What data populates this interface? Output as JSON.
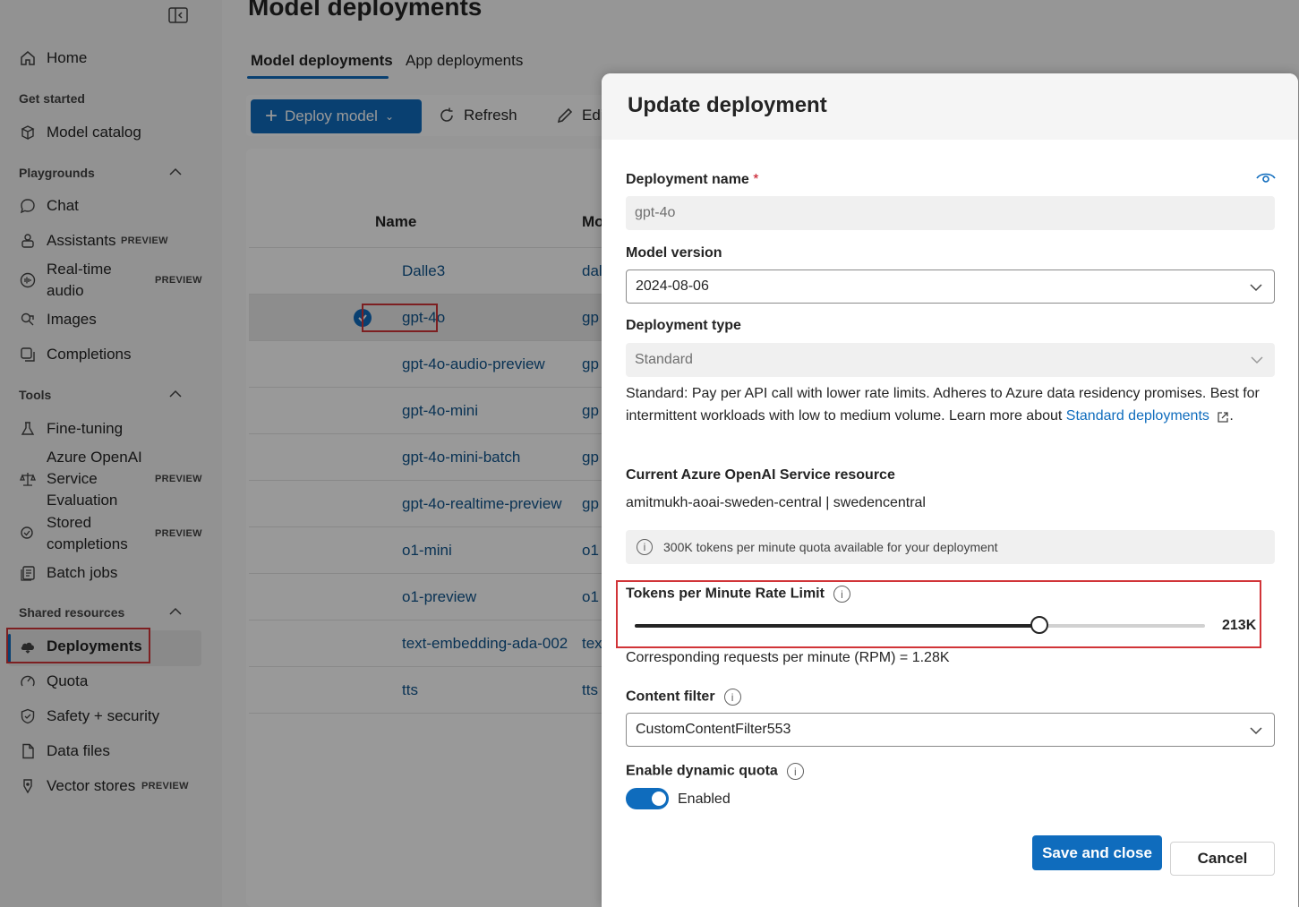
{
  "sidebar": {
    "home": "Home",
    "get_started": "Get started",
    "model_catalog": "Model catalog",
    "playgrounds": "Playgrounds",
    "chat": "Chat",
    "assistants": "Assistants",
    "realtime_audio_1": "Real-time",
    "realtime_audio_2": "audio",
    "images": "Images",
    "completions": "Completions",
    "tools": "Tools",
    "fine_tuning": "Fine-tuning",
    "aoai_eval_1": "Azure OpenAI",
    "aoai_eval_2": "Service",
    "aoai_eval_3": "Evaluation",
    "stored_1": "Stored",
    "stored_2": "completions",
    "batch_jobs": "Batch jobs",
    "shared_resources": "Shared resources",
    "deployments": "Deployments",
    "quota": "Quota",
    "safety": "Safety + security",
    "data_files": "Data files",
    "vector_stores": "Vector stores",
    "preview_badge": "PREVIEW"
  },
  "main": {
    "title": "Model deployments",
    "tab_model": "Model deployments",
    "tab_app": "App deployments",
    "deploy_model": "Deploy model",
    "refresh": "Refresh",
    "edit": "Edi",
    "col_name": "Name",
    "col_model": "Mo",
    "rows": [
      {
        "name": "Dalle3",
        "model": "dal"
      },
      {
        "name": "gpt-4o",
        "model": "gp"
      },
      {
        "name": "gpt-4o-audio-preview",
        "model": "gp"
      },
      {
        "name": "gpt-4o-mini",
        "model": "gp"
      },
      {
        "name": "gpt-4o-mini-batch",
        "model": "gp"
      },
      {
        "name": "gpt-4o-realtime-preview",
        "model": "gp"
      },
      {
        "name": "o1-mini",
        "model": "o1"
      },
      {
        "name": "o1-preview",
        "model": "o1"
      },
      {
        "name": "text-embedding-ada-002",
        "model": "tex"
      },
      {
        "name": "tts",
        "model": "tts"
      }
    ]
  },
  "panel": {
    "title": "Update deployment",
    "deployment_name_label": "Deployment name",
    "required_mark": "*",
    "deployment_name_value": "gpt-4o",
    "model_version_label": "Model version",
    "model_version_value": "2024-08-06",
    "deployment_type_label": "Deployment type",
    "deployment_type_value": "Standard",
    "desc_text": "Standard: Pay per API call with lower rate limits. Adheres to Azure data residency promises. Best for intermittent workloads with low to medium volume. Learn more about ",
    "desc_link": "Standard deployments",
    "desc_end": ".",
    "resource_label": "Current Azure OpenAI Service resource",
    "resource_value": "amitmukh-aoai-sweden-central | swedencentral",
    "quota_info": "300K tokens per minute quota available for your deployment",
    "tpm_label": "Tokens per Minute Rate Limit",
    "tpm_value_text": "213K",
    "tpm_fraction": 0.71,
    "rpm_text": "Corresponding requests per minute (RPM) = 1.28K",
    "content_filter_label": "Content filter",
    "content_filter_value": "CustomContentFilter553",
    "dynamic_quota_label": "Enable dynamic quota",
    "dynamic_quota_state": "Enabled",
    "save_close": "Save and close",
    "cancel": "Cancel"
  },
  "colors": {
    "accent": "#0f6cbd",
    "highlight": "#d13438"
  }
}
